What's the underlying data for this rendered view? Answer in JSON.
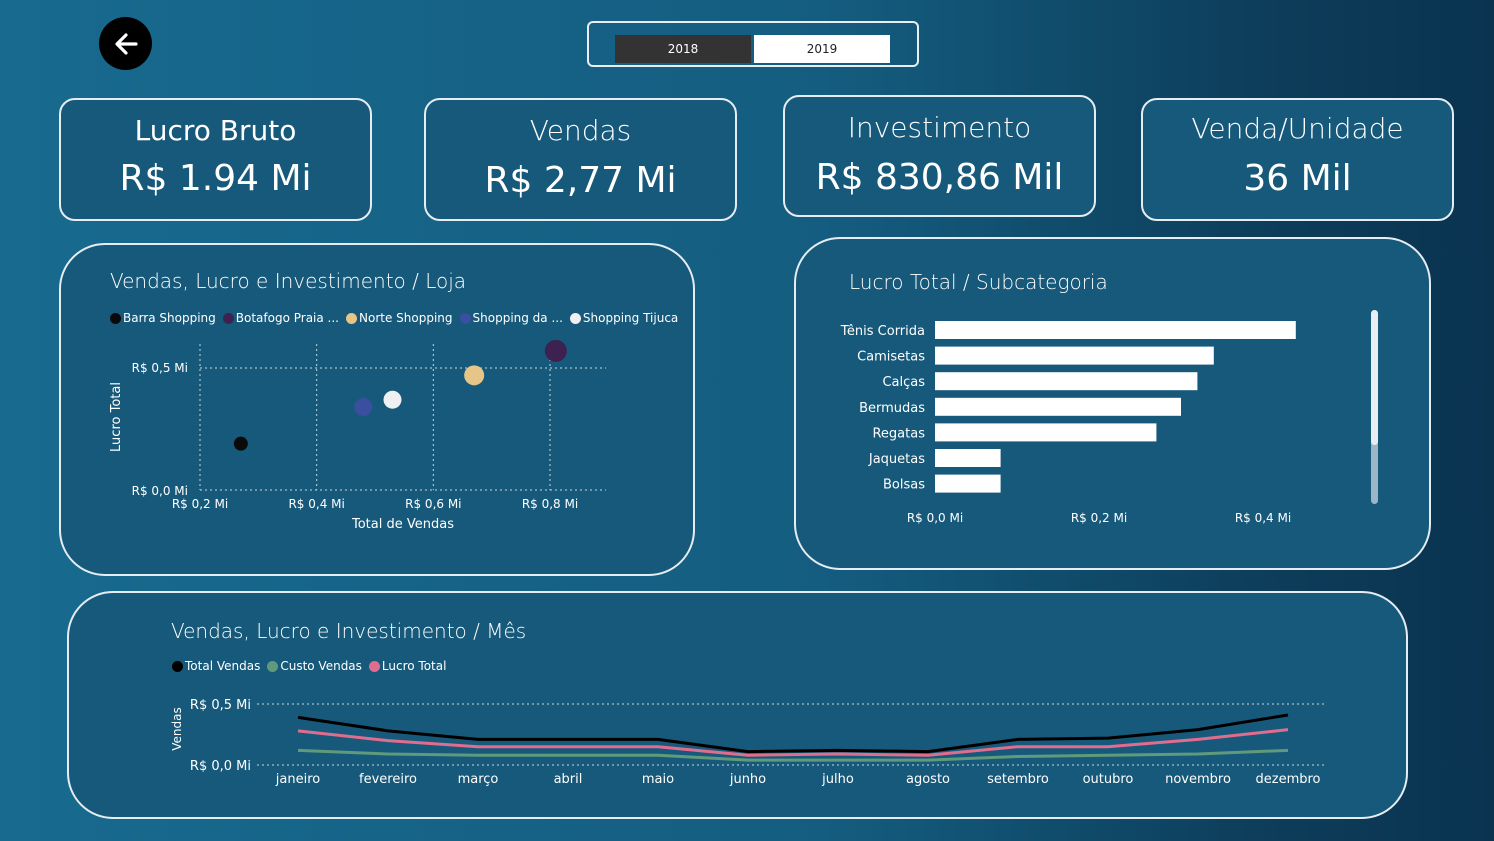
{
  "header": {
    "back_icon": "arrow-left-icon",
    "years": [
      "2018",
      "2019"
    ],
    "selected_year": "2019"
  },
  "kpis": [
    {
      "label": "Lucro Bruto",
      "value": "R$ 1.94 Mi"
    },
    {
      "label": "Vendas",
      "value": "R$ 2,77 Mi"
    },
    {
      "label": "Investimento",
      "value": "R$ 830,86 Mil"
    },
    {
      "label": "Venda/Unidade",
      "value": "36 Mil"
    }
  ],
  "chart_data": [
    {
      "type": "scatter",
      "title": "Vendas, Lucro e Investimento / Loja",
      "xlabel": "Total de Vendas",
      "ylabel": "Lucro Total",
      "xlim": [
        0.2,
        0.8
      ],
      "ylim": [
        0.0,
        0.5
      ],
      "x_ticks": [
        "R$ 0,2 Mi",
        "R$ 0,4 Mi",
        "R$ 0,6 Mi",
        "R$ 0,8 Mi"
      ],
      "y_ticks": [
        "R$ 0,0 Mi",
        "R$ 0,5 Mi"
      ],
      "legend_position": "top-left",
      "grid": true,
      "series": [
        {
          "name": "Barra Shopping",
          "color": "#0a0a0a",
          "x": 0.27,
          "y": 0.19,
          "size": 7
        },
        {
          "name": "Botafogo Praia ...",
          "color": "#3d2150",
          "x": 0.81,
          "y": 0.57,
          "size": 11
        },
        {
          "name": "Norte Shopping",
          "color": "#e5c688",
          "x": 0.67,
          "y": 0.47,
          "size": 10
        },
        {
          "name": "Shopping da ...",
          "color": "#3a4fa0",
          "x": 0.48,
          "y": 0.34,
          "size": 9
        },
        {
          "name": "Shopping Tijuca",
          "color": "#eef0f2",
          "x": 0.53,
          "y": 0.37,
          "size": 9
        }
      ]
    },
    {
      "type": "bar",
      "orientation": "horizontal",
      "title": "Lucro Total / Subcategoria",
      "categories": [
        "Tênis Corrida",
        "Camisetas",
        "Calças",
        "Bermudas",
        "Regatas",
        "Jaquetas",
        "Bolsas"
      ],
      "values": [
        0.44,
        0.34,
        0.32,
        0.3,
        0.27,
        0.08,
        0.08
      ],
      "xlim": [
        0.0,
        0.4
      ],
      "x_ticks": [
        "R$ 0,0 Mi",
        "R$ 0,2 Mi",
        "R$ 0,4 Mi"
      ],
      "bar_color": "#ffffff",
      "grid": false
    },
    {
      "type": "line",
      "title": "Vendas, Lucro e Investimento / Mês",
      "ylabel": "Vendas",
      "categories": [
        "janeiro",
        "fevereiro",
        "março",
        "abril",
        "maio",
        "junho",
        "julho",
        "agosto",
        "setembro",
        "outubro",
        "novembro",
        "dezembro"
      ],
      "ylim": [
        0.0,
        0.5
      ],
      "y_ticks": [
        "R$ 0,0 Mi",
        "R$ 0,5 Mi"
      ],
      "legend_position": "top-left",
      "series": [
        {
          "name": "Total Vendas",
          "color": "#000000",
          "values": [
            0.39,
            0.28,
            0.21,
            0.21,
            0.21,
            0.11,
            0.12,
            0.11,
            0.21,
            0.22,
            0.29,
            0.41
          ]
        },
        {
          "name": "Custo Vendas",
          "color": "#5f9a7c",
          "values": [
            0.12,
            0.09,
            0.08,
            0.08,
            0.08,
            0.04,
            0.04,
            0.04,
            0.07,
            0.08,
            0.09,
            0.12
          ]
        },
        {
          "name": "Lucro Total",
          "color": "#e06c8e",
          "values": [
            0.28,
            0.2,
            0.15,
            0.15,
            0.15,
            0.08,
            0.09,
            0.08,
            0.15,
            0.15,
            0.21,
            0.29
          ]
        }
      ]
    }
  ]
}
